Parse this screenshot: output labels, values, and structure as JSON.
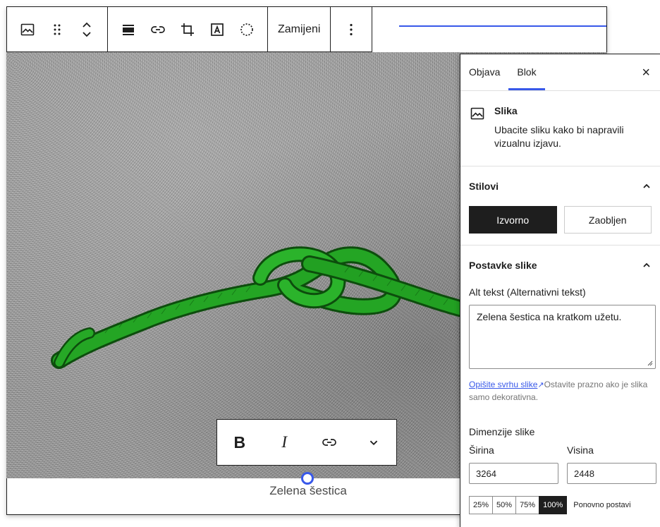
{
  "toolbar": {
    "replace_label": "Zamijeni"
  },
  "caption": {
    "text": "Zelena šestica"
  },
  "sidebar": {
    "tabs": [
      "Objava",
      "Blok"
    ],
    "close_label": "×",
    "block_card": {
      "title": "Slika",
      "description": "Ubacite sliku kako bi napravili vizualnu izjavu."
    },
    "styles": {
      "heading": "Stilovi",
      "options": [
        "Izvorno",
        "Zaobljen"
      ]
    },
    "image_settings": {
      "heading": "Postavke slike",
      "alt_label": "Alt tekst (Alternativni tekst)",
      "alt_value": "Zelena šestica na kratkom užetu.",
      "help_link": "Opišite svrhu slike",
      "help_text": "Ostavite prazno ako je slika samo dekorativna.",
      "dimensions_label": "Dimenzije slike",
      "width_label": "Širina",
      "width_value": "3264",
      "height_label": "Visina",
      "height_value": "2448",
      "percent_options": [
        "25%",
        "50%",
        "75%",
        "100%"
      ],
      "reset_label": "Ponovno postavi"
    }
  },
  "colors": {
    "accent": "#3858e9",
    "dark": "#1e1e1e",
    "rope": "#1f9a1f"
  }
}
